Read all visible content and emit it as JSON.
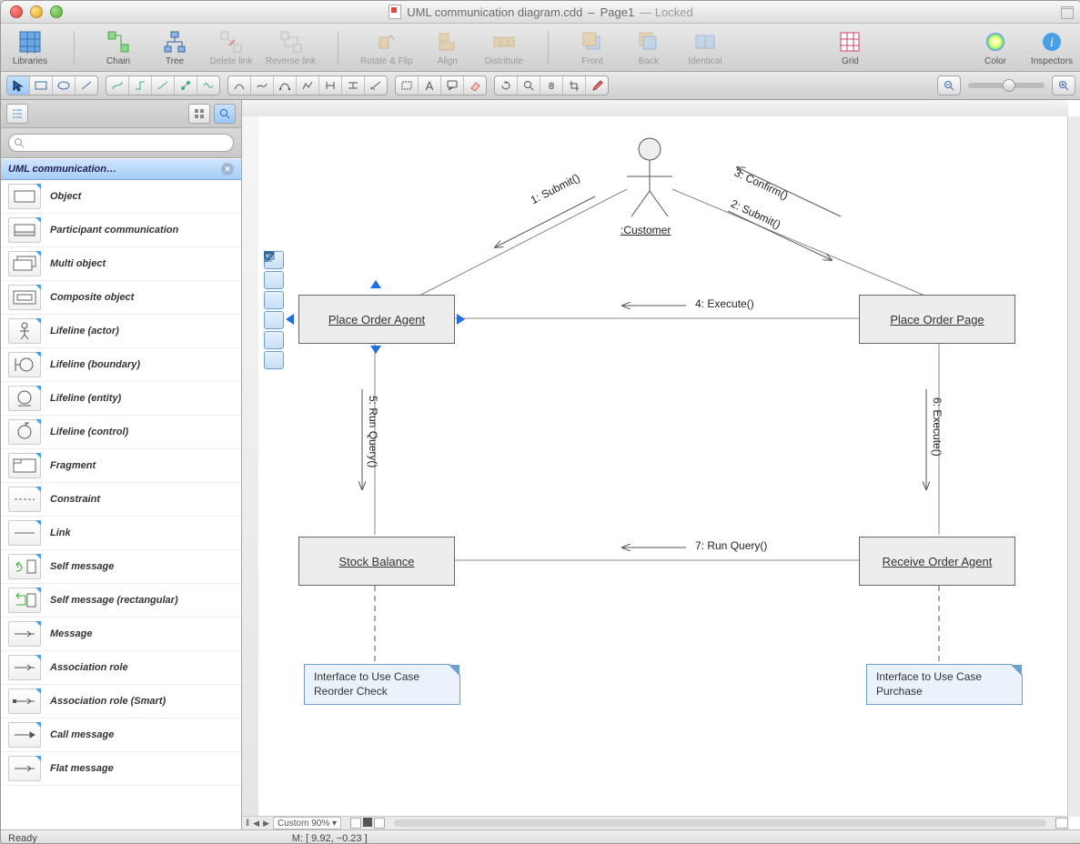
{
  "window": {
    "filename": "UML communication diagram.cdd",
    "page": "Page1",
    "locked_suffix": "Locked"
  },
  "toolbar": {
    "libraries": "Libraries",
    "chain": "Chain",
    "tree": "Tree",
    "delete_link": "Delete link",
    "reverse_link": "Reverse link",
    "rotate_flip": "Rotate & Flip",
    "align": "Align",
    "distribute": "Distribute",
    "front": "Front",
    "back": "Back",
    "identical": "Identical",
    "grid": "Grid",
    "color": "Color",
    "inspectors": "Inspectors"
  },
  "library": {
    "header": "UML communication…",
    "items": [
      "Object",
      "Participant communication",
      "Multi object",
      "Composite object",
      "Lifeline (actor)",
      "Lifeline (boundary)",
      "Lifeline (entity)",
      "Lifeline (control)",
      "Fragment",
      "Constraint",
      "Link",
      "Self message",
      "Self message (rectangular)",
      "Message",
      "Association role",
      "Association role (Smart)",
      "Call message",
      "Flat message"
    ]
  },
  "search": {
    "placeholder": ""
  },
  "diagram": {
    "actor_label": ":Customer",
    "objects": {
      "place_order_agent": "Place Order Agent",
      "place_order_page": "Place Order Page",
      "stock_balance": "Stock Balance",
      "receive_order_agent": "Receive Order Agent"
    },
    "messages": {
      "m1": "1: Submit()",
      "m2": "2: Submit()",
      "m3": "3: Confirm()",
      "m4": "4: Execute()",
      "m5": "5: Run Query()",
      "m6": "6: Execute()",
      "m7": "7: Run Query()"
    },
    "notes": {
      "left_l1": "Interface to Use Case",
      "left_l2": "Reorder Check",
      "right_l1": "Interface to Use Case",
      "right_l2": "Purchase"
    }
  },
  "footer": {
    "zoom": "Custom 90%",
    "paging_icons": [
      "◀",
      "▶"
    ]
  },
  "status": {
    "ready": "Ready",
    "mouse": "M: [ 9.92, −0.23 ]"
  }
}
